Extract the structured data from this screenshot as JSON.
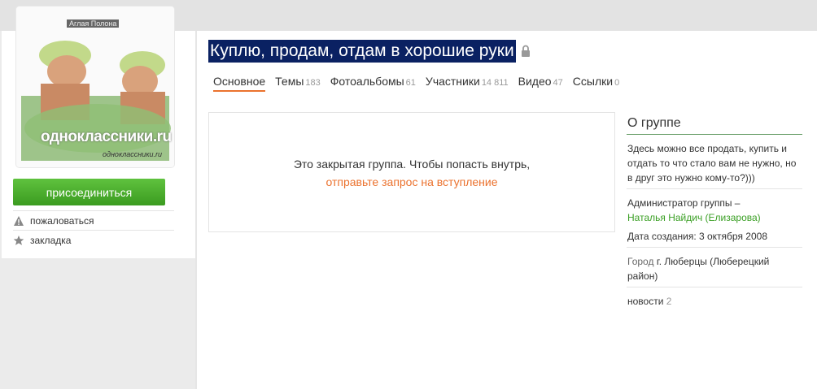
{
  "group": {
    "title": "Куплю, продам, отдам в хорошие руки",
    "avatar_label": "Аглая Полона",
    "avatar_watermark": "одноклассники.ru",
    "avatar_watermark_small": "одноклассники.ru"
  },
  "sidebar": {
    "join_label": "присоединиться",
    "report_label": "пожаловаться",
    "bookmark_label": "закладка"
  },
  "tabs": [
    {
      "label": "Основное",
      "count": ""
    },
    {
      "label": "Темы",
      "count": "183"
    },
    {
      "label": "Фотоальбомы",
      "count": "61"
    },
    {
      "label": "Участники",
      "count": "14 811"
    },
    {
      "label": "Видео",
      "count": "47"
    },
    {
      "label": "Ссылки",
      "count": "0"
    }
  ],
  "closed": {
    "line1": "Это закрытая группа. Чтобы попасть внутрь,",
    "link": "отправьте запрос на вступление"
  },
  "about": {
    "title": "О группе",
    "description": "Здесь можно все продать, купить и отдать то что стало вам не нужно, но в друг это нужно кому-то?)))",
    "admin_label": "Администратор группы –",
    "admin_name": "Наталья Найдич (Елизарова)",
    "created": "Дата создания: 3 октября 2008",
    "city_label": "Город",
    "city_value": "г. Люберцы (Люберецкий район)",
    "news_label": "новости",
    "news_count": "2"
  },
  "colors": {
    "accent": "#eb722e",
    "join_green": "#4caf32",
    "title_bg": "#0a2162",
    "link_green": "#3a9f24"
  },
  "icons": [
    "warning-icon",
    "star-icon",
    "lock-icon"
  ]
}
